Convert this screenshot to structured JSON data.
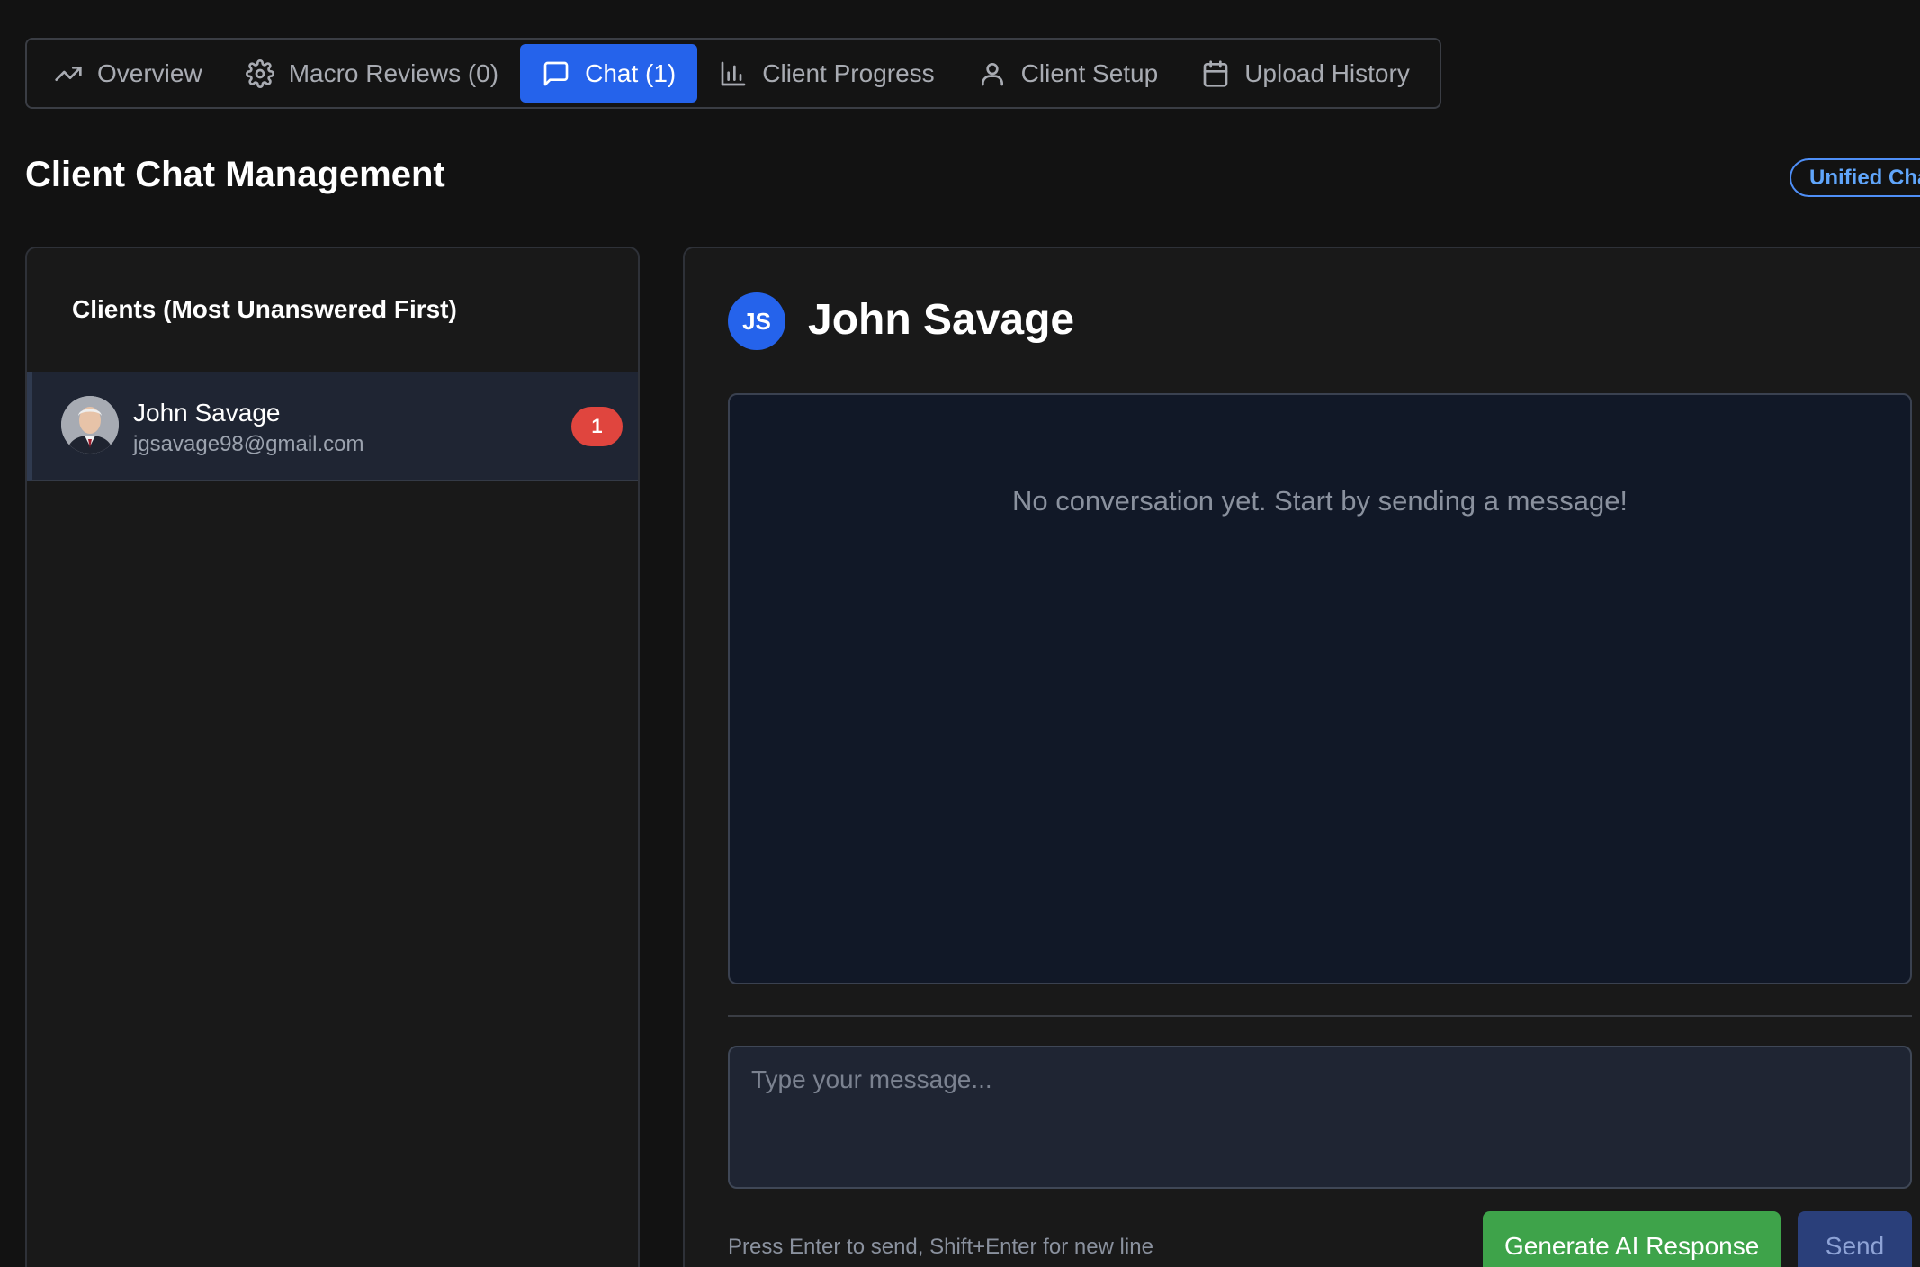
{
  "tabs": [
    {
      "label": "Overview",
      "icon": "trending-up-icon",
      "active": false
    },
    {
      "label": "Macro Reviews (0)",
      "icon": "gear-icon",
      "active": false
    },
    {
      "label": "Chat (1)",
      "icon": "chat-bubble-icon",
      "active": true
    },
    {
      "label": "Client Progress",
      "icon": "bar-chart-icon",
      "active": false
    },
    {
      "label": "Client Setup",
      "icon": "user-icon",
      "active": false
    },
    {
      "label": "Upload History",
      "icon": "calendar-icon",
      "active": false
    }
  ],
  "page": {
    "title": "Client Chat Management",
    "badge": "Unified Cha"
  },
  "client_list": {
    "title": "Clients (Most Unanswered First)",
    "clients": [
      {
        "name": "John Savage",
        "email": "jgsavage98@gmail.com",
        "unread": "1"
      }
    ]
  },
  "chat": {
    "initials": "JS",
    "name": "John Savage",
    "empty_message": "No conversation yet. Start by sending a message!",
    "input_placeholder": "Type your message...",
    "hint": "Press Enter to send, Shift+Enter for new line",
    "generate_label": "Generate AI Response",
    "send_label": "Send"
  },
  "colors": {
    "background": "#121212",
    "accent": "#2563eb",
    "unread_badge": "#e0453e",
    "generate_button": "#3ea34a",
    "send_button": "#2a3f7a"
  }
}
